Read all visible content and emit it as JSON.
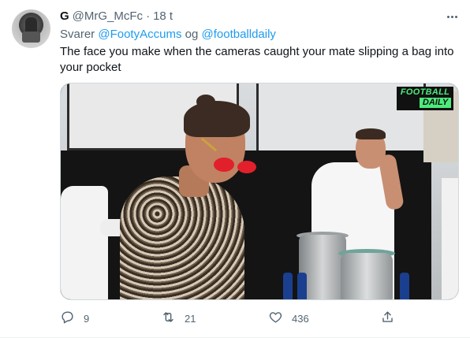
{
  "tweet": {
    "author_name": "G",
    "author_handle": "@MrG_McFc",
    "separator": "·",
    "time": "18 t",
    "reply_prefix": "Svarer",
    "reply_mention_1": "@FootyAccums",
    "reply_joiner": "og",
    "reply_mention_2": "@footballdaily",
    "text": "The face you make when the cameras caught your mate slipping a bag into your pocket"
  },
  "media": {
    "badge_line1": "FOOTBALL",
    "badge_line2": "DAILY",
    "badge_color": "#4dea7c"
  },
  "actions": {
    "reply_icon": "reply-icon",
    "reply_count": "9",
    "retweet_icon": "retweet-icon",
    "retweet_count": "21",
    "like_icon": "heart-icon",
    "like_count": "436",
    "share_icon": "share-icon"
  },
  "colors": {
    "link": "#1d9bf0",
    "secondary_text": "#536471",
    "primary_text": "#0f1419"
  }
}
